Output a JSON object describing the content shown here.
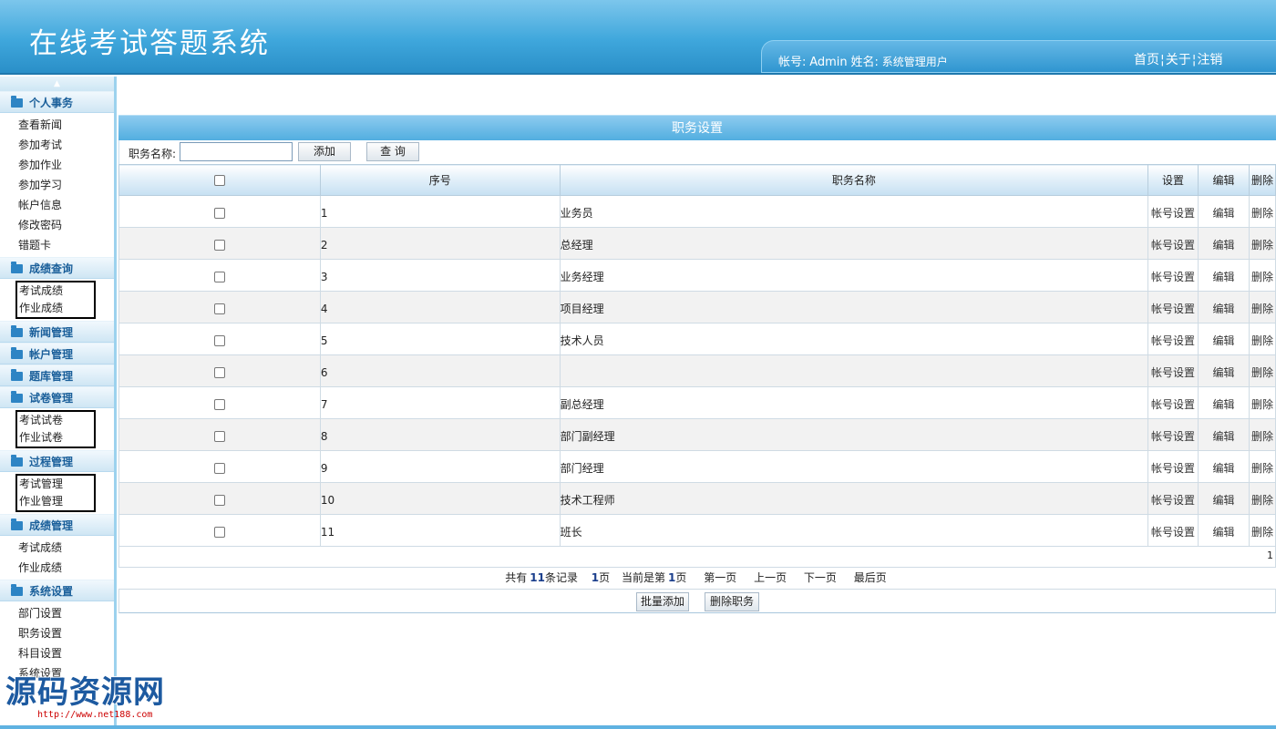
{
  "app": {
    "title": "在线考试答题系统"
  },
  "userbar": {
    "account_label": "帐号:",
    "account_value": "Admin",
    "name_label": "姓名:",
    "name_value": "系统管理用户",
    "links": [
      "首页",
      "关于",
      "注销"
    ]
  },
  "sidebar": {
    "groups": [
      {
        "title": "个人事务",
        "items": [
          "查看新闻",
          "参加考试",
          "参加作业",
          "参加学习",
          "帐户信息",
          "修改密码",
          "错题卡"
        ]
      },
      {
        "title": "成绩查询",
        "items": [
          "考试成绩",
          "作业成绩"
        ]
      },
      {
        "title": "新闻管理",
        "items": []
      },
      {
        "title": "帐户管理",
        "items": []
      },
      {
        "title": "题库管理",
        "items": []
      },
      {
        "title": "试卷管理",
        "items": [
          "考试试卷",
          "作业试卷"
        ]
      },
      {
        "title": "过程管理",
        "items": [
          "考试管理",
          "作业管理"
        ]
      },
      {
        "title": "成绩管理",
        "items": [
          "考试成绩",
          "作业成绩"
        ]
      },
      {
        "title": "系统设置",
        "items": [
          "部门设置",
          "职务设置",
          "科目设置",
          "系统设置"
        ]
      }
    ]
  },
  "watermark": {
    "text": "源码资源网",
    "url": "http://www.net188.com"
  },
  "panel": {
    "title": "职务设置"
  },
  "search": {
    "label": "职务名称:",
    "value": "",
    "add_button": "添加",
    "query_button": "查 询"
  },
  "table": {
    "headers": [
      "序号",
      "职务名称",
      "设置",
      "编辑",
      "删除"
    ],
    "rows": [
      {
        "no": "1",
        "name": "业务员",
        "set": "帐号设置",
        "edit": "编辑",
        "del": "删除"
      },
      {
        "no": "2",
        "name": "总经理",
        "set": "帐号设置",
        "edit": "编辑",
        "del": "删除"
      },
      {
        "no": "3",
        "name": "业务经理",
        "set": "帐号设置",
        "edit": "编辑",
        "del": "删除"
      },
      {
        "no": "4",
        "name": "项目经理",
        "set": "帐号设置",
        "edit": "编辑",
        "del": "删除"
      },
      {
        "no": "5",
        "name": "技术人员",
        "set": "帐号设置",
        "edit": "编辑",
        "del": "删除"
      },
      {
        "no": "6",
        "name": "",
        "set": "帐号设置",
        "edit": "编辑",
        "del": "删除"
      },
      {
        "no": "7",
        "name": "副总经理",
        "set": "帐号设置",
        "edit": "编辑",
        "del": "删除"
      },
      {
        "no": "8",
        "name": "部门副经理",
        "set": "帐号设置",
        "edit": "编辑",
        "del": "删除"
      },
      {
        "no": "9",
        "name": "部门经理",
        "set": "帐号设置",
        "edit": "编辑",
        "del": "删除"
      },
      {
        "no": "10",
        "name": "技术工程师",
        "set": "帐号设置",
        "edit": "编辑",
        "del": "删除"
      },
      {
        "no": "11",
        "name": "班长",
        "set": "帐号设置",
        "edit": "编辑",
        "del": "删除"
      }
    ]
  },
  "pager": {
    "page_marker": "1",
    "total_prefix": "共有",
    "total_count": "11",
    "total_suffix": "条记录",
    "pages_count": "1",
    "pages_suffix": "页",
    "current_prefix": "当前是第",
    "current_page": "1",
    "current_suffix": "页",
    "first": "第一页",
    "prev": "上一页",
    "next": "下一页",
    "last": "最后页"
  },
  "actions": {
    "batch_add": "批量添加",
    "delete": "删除职务"
  }
}
